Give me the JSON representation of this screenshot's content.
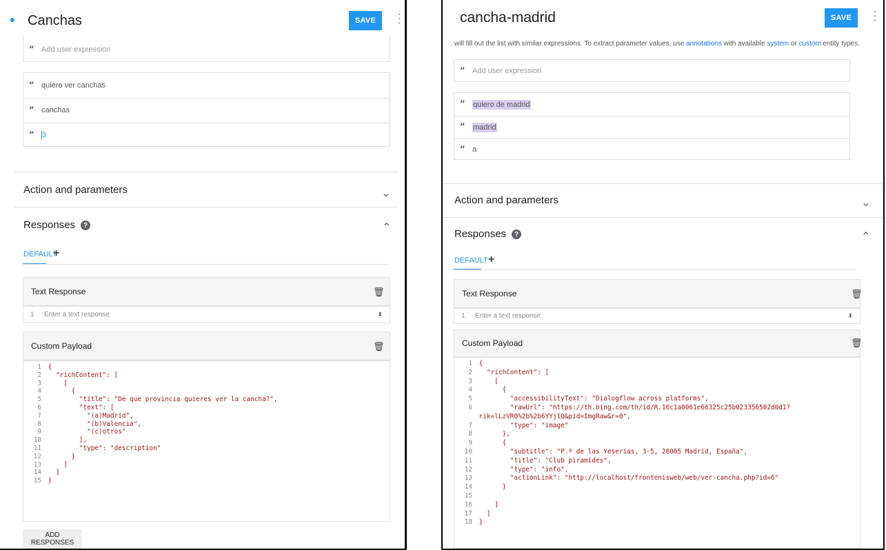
{
  "left": {
    "title": "Canchas",
    "save_label": "SAVE",
    "add_expression_placeholder": "Add user expression",
    "expressions": [
      "quiero ver canchas",
      "canchas",
      "3"
    ],
    "action_section_title": "Action and parameters",
    "responses_title": "Responses",
    "tab_default": "DEFAULT",
    "text_response_title": "Text Response",
    "text_response_line": "1",
    "text_response_placeholder": "Enter a text response",
    "custom_payload_title": "Custom Payload",
    "code_lines": [
      {
        "n": "1",
        "text": "{"
      },
      {
        "n": "2",
        "text": "  \"richContent\": ["
      },
      {
        "n": "3",
        "text": "    ["
      },
      {
        "n": "4",
        "text": "      {"
      },
      {
        "n": "5",
        "text": "        \"title\": \"De que provincia quieres ver la cancha?\","
      },
      {
        "n": "6",
        "text": "        \"text\": ["
      },
      {
        "n": "7",
        "text": "          \"(a)Madrid\","
      },
      {
        "n": "8",
        "text": "          \"(b)Valencia\","
      },
      {
        "n": "9",
        "text": "          \"(c)otros\""
      },
      {
        "n": "10",
        "text": "        ],"
      },
      {
        "n": "11",
        "text": "        \"type\": \"description\""
      },
      {
        "n": "12",
        "text": "      }"
      },
      {
        "n": "13",
        "text": "    ]"
      },
      {
        "n": "14",
        "text": "  ]"
      },
      {
        "n": "15",
        "text": "}"
      }
    ],
    "add_responses_label": "ADD RESPONSES"
  },
  "right": {
    "title": "cancha-madrid",
    "save_label": "SAVE",
    "hint_prefix": "will fill out the list with similar expressions. To extract parameter values, use ",
    "hint_link1": "annotations",
    "hint_mid": " with available ",
    "hint_link2": "system",
    "hint_or": " or ",
    "hint_link3": "custom",
    "hint_suffix": " entity types.",
    "add_expression_placeholder": "Add user expression",
    "expressions": [
      "quiero de madrid",
      "madrid",
      "a"
    ],
    "action_section_title": "Action and parameters",
    "responses_title": "Responses",
    "tab_default": "DEFAULT",
    "text_response_title": "Text Response",
    "text_response_line": "1",
    "text_response_placeholder": "Enter a text response",
    "custom_payload_title": "Custom Payload",
    "code_lines": [
      {
        "n": "1",
        "text": "{"
      },
      {
        "n": "2",
        "text": "  \"richContent\": ["
      },
      {
        "n": "3",
        "text": "    ["
      },
      {
        "n": "4",
        "text": "      {"
      },
      {
        "n": "5",
        "text": "        \"accessibilityText\": \"Dialogflow across platforms\","
      },
      {
        "n": "6",
        "text": "        \"rawUrl\": \"https://th.bing.com/th/id/R.16c1a0061e66325c25b023356502d0d1?"
      },
      {
        "n": "",
        "text": "rik=lLzVR0%2b%2b6YYj1Q&pid=ImgRaw&r=0\","
      },
      {
        "n": "7",
        "text": "        \"type\": \"image\""
      },
      {
        "n": "8",
        "text": "      },"
      },
      {
        "n": "9",
        "text": "      {"
      },
      {
        "n": "10",
        "text": "        \"subtitle\": \"P.º de las Yeserías, 3-5, 28005 Madrid, España\","
      },
      {
        "n": "11",
        "text": "        \"title\": \"Club piramides\","
      },
      {
        "n": "12",
        "text": "        \"type\": \"info\","
      },
      {
        "n": "13",
        "text": "        \"actionLink\": \"http://localhost/frontenisweb/web/ver-cancha.php?id=6\""
      },
      {
        "n": "14",
        "text": "      }"
      },
      {
        "n": "15",
        "text": ""
      },
      {
        "n": "16",
        "text": "    ]"
      },
      {
        "n": "17",
        "text": "  ]"
      },
      {
        "n": "18",
        "text": "}"
      }
    ]
  }
}
